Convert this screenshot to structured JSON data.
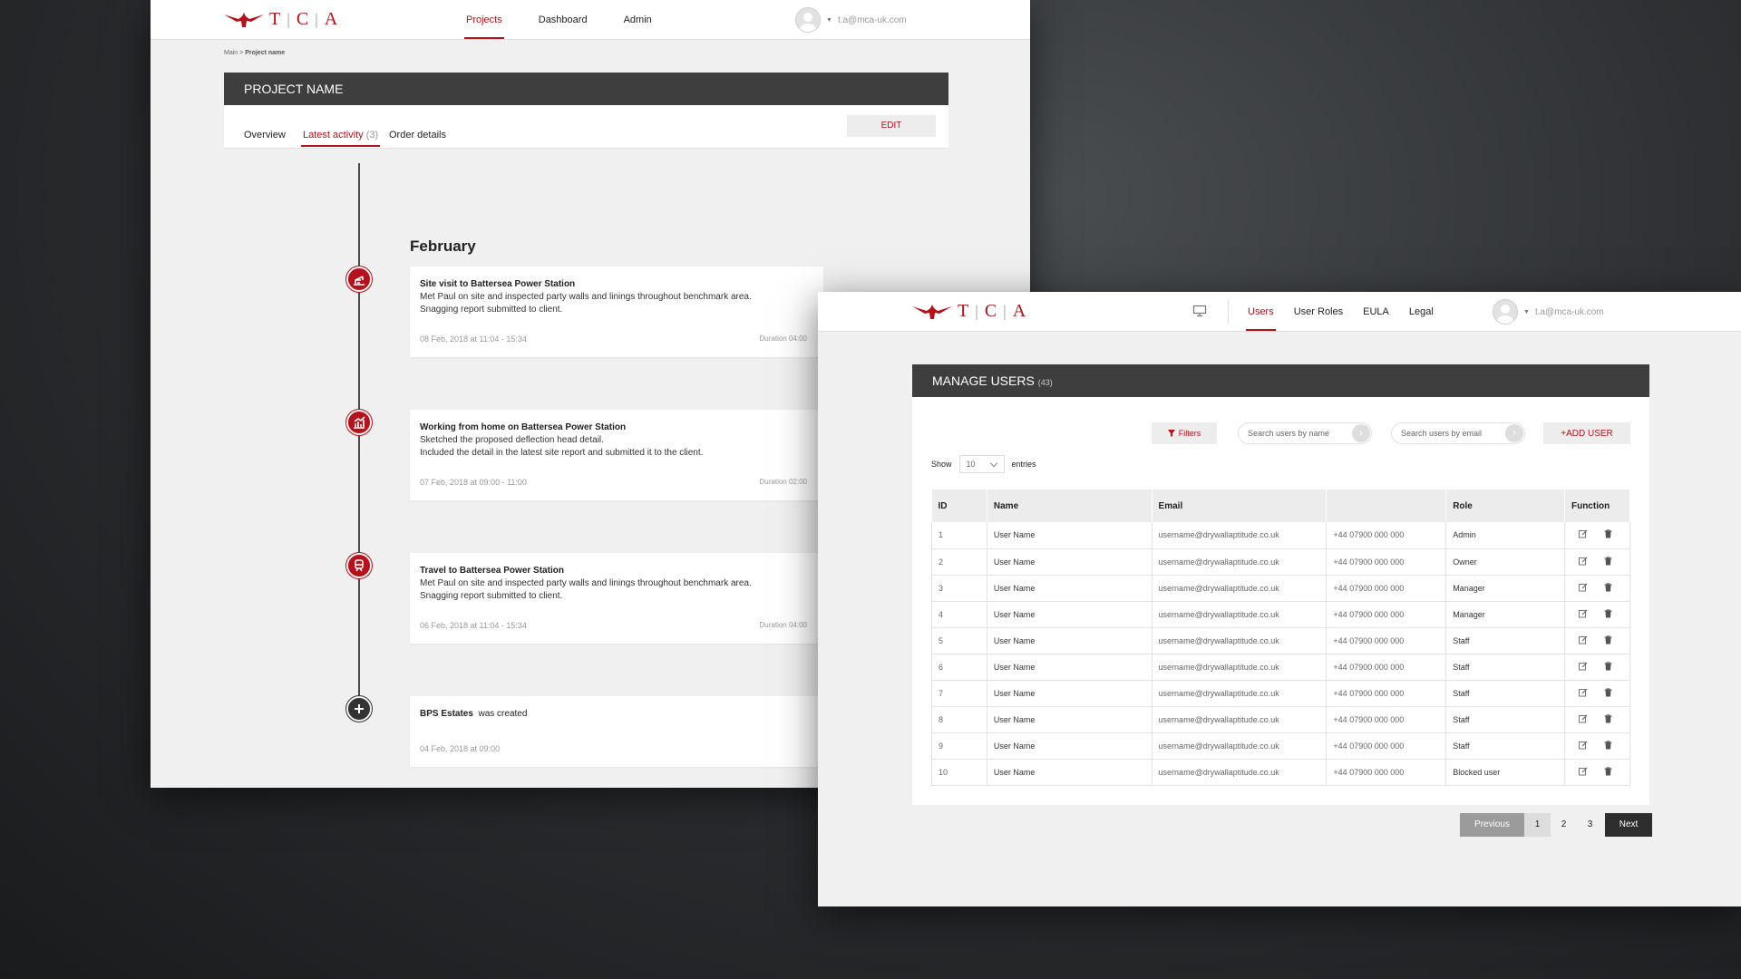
{
  "brand": {
    "letters": [
      "T",
      "C",
      "A"
    ],
    "accent": "#b4121c",
    "header_dark": "#3e3e3e"
  },
  "project_screen": {
    "nav": [
      {
        "label": "Projects",
        "active": true
      },
      {
        "label": "Dashboard",
        "active": false
      },
      {
        "label": "Admin",
        "active": false
      }
    ],
    "user_email": "t.a@mca-uk.com",
    "breadcrumb": {
      "root": "Main",
      "separator": ">",
      "current": "Project name"
    },
    "title": "PROJECT NAME",
    "tabs": {
      "overview": "Overview",
      "latest": "Latest activity",
      "latest_count": "(3)",
      "order": "Order details"
    },
    "edit_label": "EDIT",
    "month": "February",
    "activities": [
      {
        "icon": "crane-icon",
        "title": "Site visit to Battersea Power Station",
        "lines": [
          "Met Paul on site and inspected party walls and linings throughout benchmark area.",
          "Snagging report submitted to client."
        ],
        "date": "08 Feb, 2018 at 11:04 - 15:34",
        "duration": "Duration 04:00"
      },
      {
        "icon": "chart-icon",
        "title": "Working from home on Battersea Power Station",
        "lines": [
          "Sketched the proposed deflection head detail.",
          "Included the detail in the latest site report and submitted it to the client."
        ],
        "date": "07 Feb, 2018 at 09:00 - 11:00",
        "duration": "Duration 02:00"
      },
      {
        "icon": "train-icon",
        "title": "Travel to Battersea Power Station",
        "lines": [
          "Met Paul on site and inspected party walls and linings throughout benchmark area.",
          "Snagging report submitted to client."
        ],
        "date": "06 Feb, 2018 at 11:04 - 15:34",
        "duration": "Duration 04:00"
      }
    ],
    "created": {
      "name": "BPS Estates",
      "text": "was created",
      "date": "04 Feb, 2018 at 09:00"
    }
  },
  "users_screen": {
    "nav": [
      {
        "label": "Users",
        "active": true
      },
      {
        "label": "User Roles",
        "active": false
      },
      {
        "label": "EULA",
        "active": false
      },
      {
        "label": "Legal",
        "active": false
      }
    ],
    "user_email": "t.a@mca-uk.com",
    "title": "MANAGE USERS",
    "count": "(43)",
    "filters_label": "Filters",
    "search_name_placeholder": "Search users by name",
    "search_email_placeholder": "Search users by email",
    "add_user_label": "+ADD USER",
    "show_label": "Show",
    "show_value": "10",
    "entries_label": "entries",
    "columns": [
      "ID",
      "Name",
      "Email",
      "",
      "Role",
      "Function"
    ],
    "rows": [
      [
        "1",
        "User Name",
        "username@drywallaptitude.co.uk",
        "+44 07900 000 000",
        "Admin"
      ],
      [
        "2",
        "User Name",
        "username@drywallaptitude.co.uk",
        "+44 07900 000 000",
        "Owner"
      ],
      [
        "3",
        "User Name",
        "username@drywallaptitude.co.uk",
        "+44 07900 000 000",
        "Manager"
      ],
      [
        "4",
        "User Name",
        "username@drywallaptitude.co.uk",
        "+44 07900 000 000",
        "Manager"
      ],
      [
        "5",
        "User Name",
        "username@drywallaptitude.co.uk",
        "+44 07900 000 000",
        "Staff"
      ],
      [
        "6",
        "User Name",
        "username@drywallaptitude.co.uk",
        "+44 07900 000 000",
        "Staff"
      ],
      [
        "7",
        "User Name",
        "username@drywallaptitude.co.uk",
        "+44 07900 000 000",
        "Staff"
      ],
      [
        "8",
        "User Name",
        "username@drywallaptitude.co.uk",
        "+44 07900 000 000",
        "Staff"
      ],
      [
        "9",
        "User Name",
        "username@drywallaptitude.co.uk",
        "+44 07900 000 000",
        "Staff"
      ],
      [
        "10",
        "User Name",
        "username@drywallaptitude.co.uk",
        "+44 07900 000 000",
        "Blocked user"
      ]
    ],
    "pagination": {
      "prev": "Previous",
      "pages": [
        "1",
        "2",
        "3"
      ],
      "current": "1",
      "next": "Next"
    }
  }
}
